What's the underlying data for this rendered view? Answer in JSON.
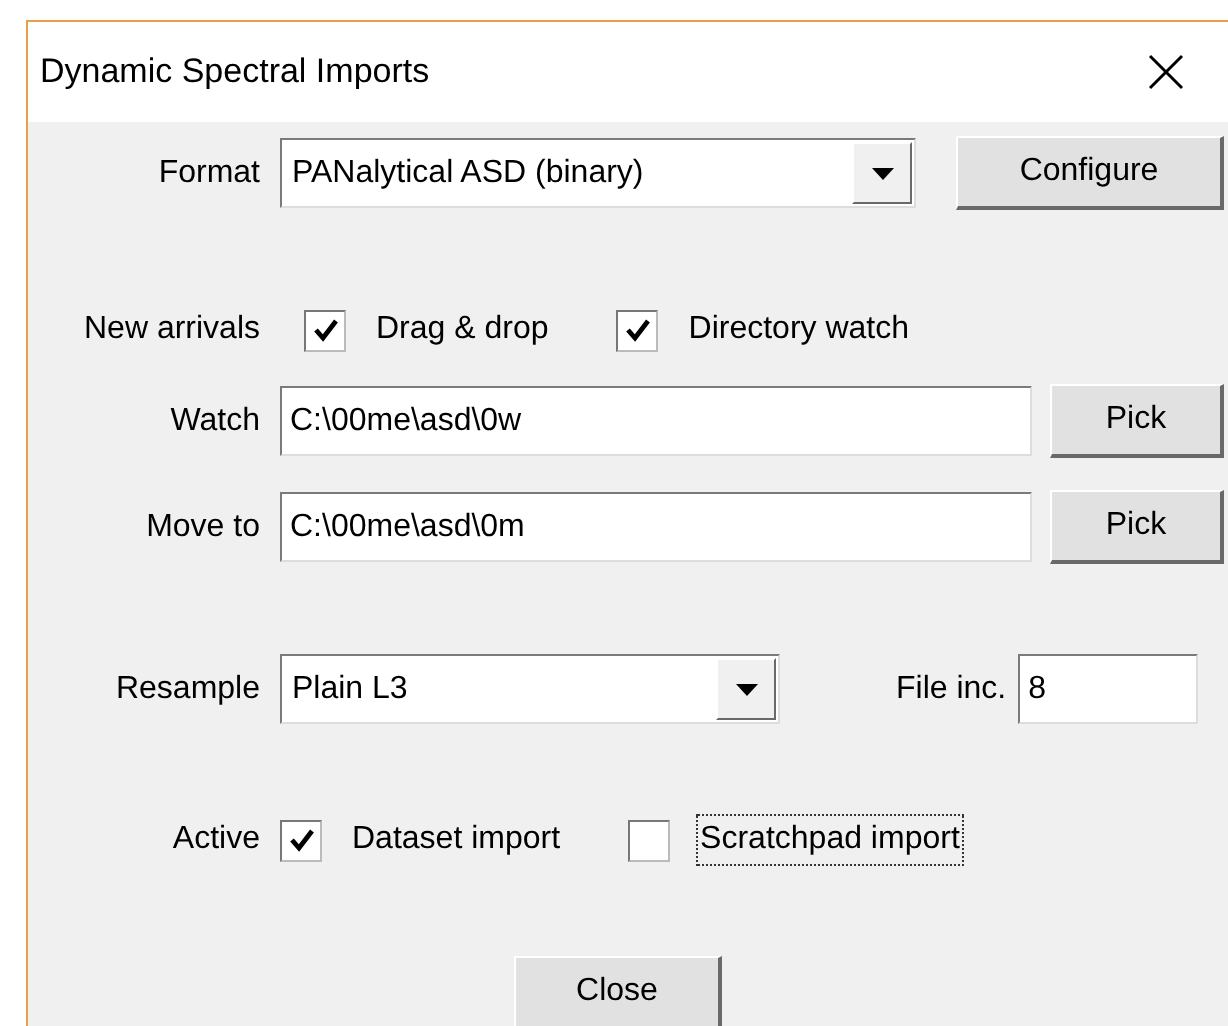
{
  "window": {
    "title": "Dynamic Spectral Imports"
  },
  "format": {
    "label": "Format",
    "value": "PANalytical ASD (binary)",
    "button": "Configure"
  },
  "new_arrivals": {
    "label": "New arrivals",
    "options": [
      {
        "label": "Drag & drop",
        "checked": true,
        "focused": false
      },
      {
        "label": "Directory watch",
        "checked": true,
        "focused": false
      }
    ]
  },
  "paths": [
    {
      "label": "Watch",
      "value": "C:\\00me\\asd\\0w",
      "button": "Pick"
    },
    {
      "label": "Move to",
      "value": "C:\\00me\\asd\\0m",
      "button": "Pick"
    }
  ],
  "resample": {
    "label": "Resample",
    "value": "Plain L3"
  },
  "file_inc": {
    "label": "File inc.",
    "value": "8"
  },
  "active": {
    "label": "Active",
    "options": [
      {
        "label": "Dataset import",
        "checked": true,
        "focused": false
      },
      {
        "label": "Scratchpad import",
        "checked": false,
        "focused": true
      }
    ]
  },
  "buttons": [
    {
      "label": "Close"
    }
  ]
}
